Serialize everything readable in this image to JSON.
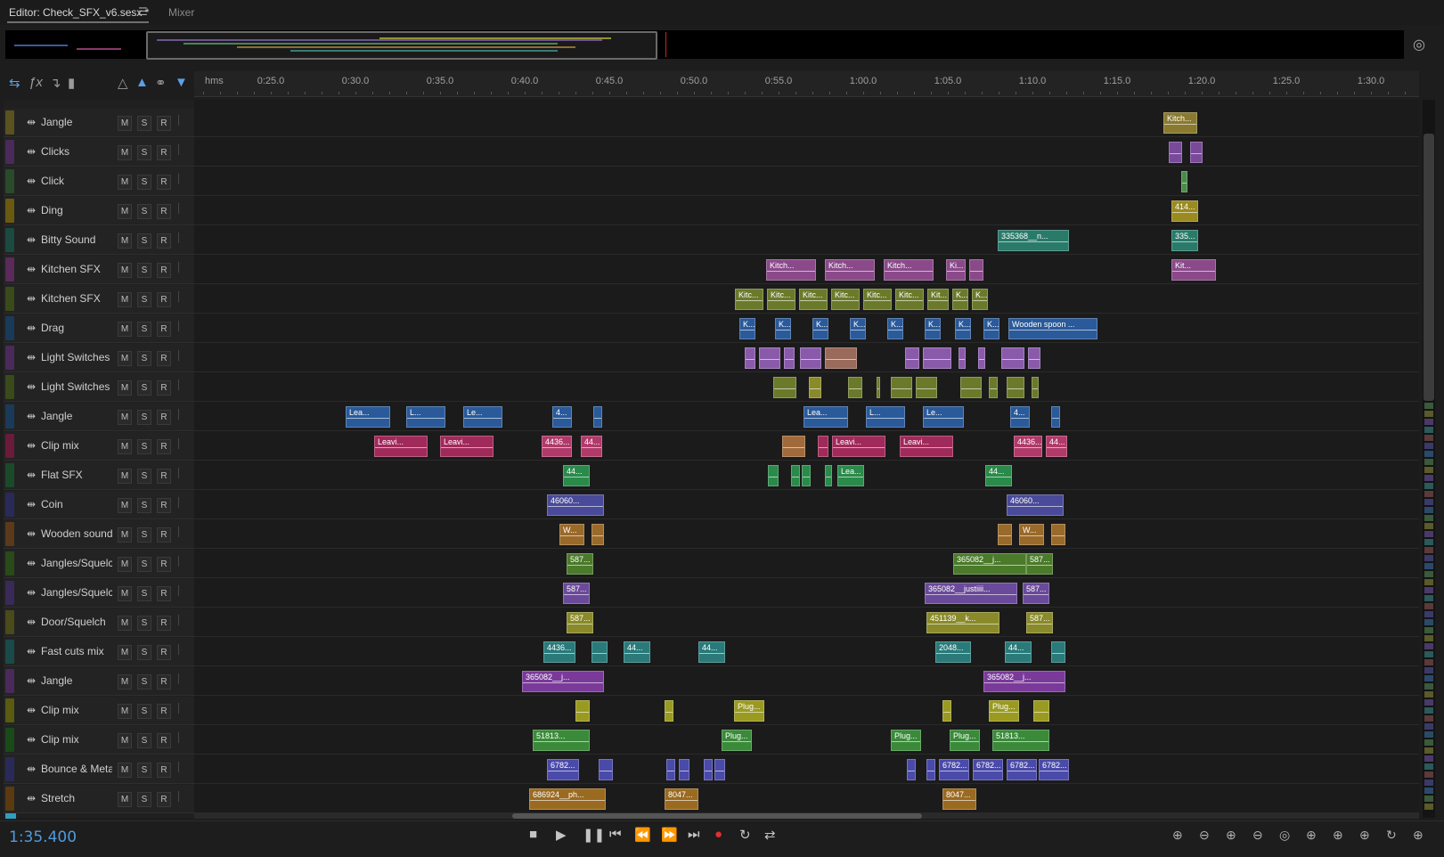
{
  "tabs": {
    "editor_label": "Editor: Check_SFX_v6.sesx *",
    "menu_icon": "hamburger-menu-icon",
    "mixer_label": "Mixer"
  },
  "ruler": {
    "unit_label": "hms",
    "labels": [
      "0:25.0",
      "0:30.0",
      "0:35.0",
      "0:40.0",
      "0:45.0",
      "0:50.0",
      "0:55.0",
      "1:00.0",
      "1:05.0",
      "1:10.0",
      "1:15.0",
      "1:20.0",
      "1:25.0",
      "1:30.0"
    ]
  },
  "button_labels": {
    "mute": "M",
    "solo": "S",
    "record": "R"
  },
  "tracks": [
    {
      "name": "Jangle",
      "color": "#5a5220",
      "clips": [
        {
          "s": 1306,
          "w": 38,
          "label": "Kitch...",
          "color": "#8a7a30"
        }
      ]
    },
    {
      "name": "Clicks",
      "color": "#4a2a5a",
      "clips": [
        {
          "s": 1312,
          "w": 15,
          "label": "",
          "color": "#7a4a9a"
        },
        {
          "s": 1336,
          "w": 14,
          "label": "",
          "color": "#7a4a9a"
        }
      ]
    },
    {
      "name": "Click",
      "color": "#2a4a2a",
      "clips": [
        {
          "s": 1326,
          "w": 7,
          "label": "",
          "color": "#4a8a4a"
        }
      ]
    },
    {
      "name": "Ding",
      "color": "#6a5a10",
      "clips": [
        {
          "s": 1315,
          "w": 30,
          "label": "414...",
          "color": "#9a8a20"
        }
      ]
    },
    {
      "name": "Bitty Sound",
      "color": "#1a4a40",
      "clips": [
        {
          "s": 1120,
          "w": 80,
          "label": "335368__n...",
          "color": "#2a7a6a"
        },
        {
          "s": 1315,
          "w": 30,
          "label": "335...",
          "color": "#2a7a6a"
        }
      ]
    },
    {
      "name": "Kitchen SFX",
      "color": "#5a2a5a",
      "clips": [
        {
          "s": 860,
          "w": 56,
          "label": "Kitch...",
          "color": "#8a4a8a"
        },
        {
          "s": 926,
          "w": 56,
          "label": "Kitch...",
          "color": "#8a4a8a"
        },
        {
          "s": 992,
          "w": 56,
          "label": "Kitch...",
          "color": "#8a4a8a"
        },
        {
          "s": 1062,
          "w": 22,
          "label": "Ki...",
          "color": "#8a4a8a"
        },
        {
          "s": 1088,
          "w": 16,
          "label": "",
          "color": "#8a4a8a"
        },
        {
          "s": 1315,
          "w": 50,
          "label": "Kit...",
          "color": "#8a4a8a"
        }
      ]
    },
    {
      "name": "Kitchen SFX",
      "color": "#3a4a1a",
      "clips": [
        {
          "s": 825,
          "w": 32,
          "label": "Kitc...",
          "color": "#6a7a2a"
        },
        {
          "s": 861,
          "w": 32,
          "label": "Kitc...",
          "color": "#6a7a2a"
        },
        {
          "s": 897,
          "w": 32,
          "label": "Kitc...",
          "color": "#6a7a2a"
        },
        {
          "s": 933,
          "w": 32,
          "label": "Kitc...",
          "color": "#6a7a2a"
        },
        {
          "s": 969,
          "w": 32,
          "label": "Kitc...",
          "color": "#6a7a2a"
        },
        {
          "s": 1005,
          "w": 32,
          "label": "Kitc...",
          "color": "#6a7a2a"
        },
        {
          "s": 1041,
          "w": 24,
          "label": "Kit...",
          "color": "#6a7a2a"
        },
        {
          "s": 1069,
          "w": 18,
          "label": "K...",
          "color": "#6a7a2a"
        },
        {
          "s": 1091,
          "w": 18,
          "label": "K...",
          "color": "#6a7a2a"
        }
      ]
    },
    {
      "name": "Drag",
      "color": "#1a3a5a",
      "clips": [
        {
          "s": 830,
          "w": 18,
          "label": "K...",
          "color": "#2a5a9a"
        },
        {
          "s": 870,
          "w": 18,
          "label": "K...",
          "color": "#2a5a9a"
        },
        {
          "s": 912,
          "w": 18,
          "label": "K...",
          "color": "#2a5a9a"
        },
        {
          "s": 954,
          "w": 18,
          "label": "K...",
          "color": "#2a5a9a"
        },
        {
          "s": 996,
          "w": 18,
          "label": "K...",
          "color": "#2a5a9a"
        },
        {
          "s": 1038,
          "w": 18,
          "label": "K...",
          "color": "#2a5a9a"
        },
        {
          "s": 1072,
          "w": 18,
          "label": "K...",
          "color": "#2a5a9a"
        },
        {
          "s": 1104,
          "w": 18,
          "label": "K...",
          "color": "#2a5a9a"
        },
        {
          "s": 1132,
          "w": 100,
          "label": "Wooden spoon ...",
          "color": "#2a5a9a"
        }
      ]
    },
    {
      "name": "Light Switches",
      "color": "#4a2a5a",
      "clips": [
        {
          "s": 836,
          "w": 12,
          "label": "",
          "color": "#8a5aaa"
        },
        {
          "s": 852,
          "w": 24,
          "label": "",
          "color": "#8a5aaa"
        },
        {
          "s": 880,
          "w": 12,
          "label": "",
          "color": "#8a5aaa"
        },
        {
          "s": 898,
          "w": 24,
          "label": "",
          "color": "#8a5aaa"
        },
        {
          "s": 926,
          "w": 36,
          "label": "",
          "color": "#9a6a5a"
        },
        {
          "s": 1016,
          "w": 16,
          "label": "",
          "color": "#8a5aaa"
        },
        {
          "s": 1036,
          "w": 32,
          "label": "",
          "color": "#8a5aaa"
        },
        {
          "s": 1076,
          "w": 8,
          "label": "",
          "color": "#8a5aaa"
        },
        {
          "s": 1098,
          "w": 8,
          "label": "",
          "color": "#8a5aaa"
        },
        {
          "s": 1124,
          "w": 26,
          "label": "",
          "color": "#8a5aaa"
        },
        {
          "s": 1154,
          "w": 14,
          "label": "",
          "color": "#8a5aaa"
        }
      ]
    },
    {
      "name": "Light Switches",
      "color": "#3a4a1a",
      "clips": [
        {
          "s": 868,
          "w": 26,
          "label": "",
          "color": "#6a7a2a"
        },
        {
          "s": 908,
          "w": 14,
          "label": "",
          "color": "#8a8a2a"
        },
        {
          "s": 952,
          "w": 16,
          "label": "",
          "color": "#6a7a2a"
        },
        {
          "s": 984,
          "w": 4,
          "label": "",
          "color": "#6a7a2a"
        },
        {
          "s": 1000,
          "w": 24,
          "label": "",
          "color": "#6a7a2a"
        },
        {
          "s": 1028,
          "w": 24,
          "label": "",
          "color": "#6a7a2a"
        },
        {
          "s": 1078,
          "w": 24,
          "label": "",
          "color": "#6a7a2a"
        },
        {
          "s": 1110,
          "w": 10,
          "label": "",
          "color": "#6a7a2a"
        },
        {
          "s": 1130,
          "w": 20,
          "label": "",
          "color": "#6a7a2a"
        },
        {
          "s": 1158,
          "w": 8,
          "label": "",
          "color": "#6a7a2a"
        }
      ]
    },
    {
      "name": "Jangle",
      "color": "#1a3a5a",
      "clips": [
        {
          "s": 388,
          "w": 50,
          "label": "Lea...",
          "color": "#2a5a9a"
        },
        {
          "s": 456,
          "w": 44,
          "label": "L...",
          "color": "#2a5a9a"
        },
        {
          "s": 520,
          "w": 44,
          "label": "Le...",
          "color": "#2a5a9a"
        },
        {
          "s": 620,
          "w": 22,
          "label": "4...",
          "color": "#2a5a9a"
        },
        {
          "s": 666,
          "w": 10,
          "label": "",
          "color": "#2a5a9a"
        },
        {
          "s": 902,
          "w": 50,
          "label": "Lea...",
          "color": "#2a5a9a"
        },
        {
          "s": 972,
          "w": 44,
          "label": "L...",
          "color": "#2a5a9a"
        },
        {
          "s": 1036,
          "w": 46,
          "label": "Le...",
          "color": "#2a5a9a"
        },
        {
          "s": 1134,
          "w": 22,
          "label": "4...",
          "color": "#2a5a9a"
        },
        {
          "s": 1180,
          "w": 10,
          "label": "",
          "color": "#2a5a9a"
        }
      ]
    },
    {
      "name": "Clip mix",
      "color": "#6a1a3a",
      "clips": [
        {
          "s": 420,
          "w": 60,
          "label": "Leavi...",
          "color": "#a02a5a"
        },
        {
          "s": 494,
          "w": 60,
          "label": "Leavi...",
          "color": "#a02a5a"
        },
        {
          "s": 608,
          "w": 34,
          "label": "4436...",
          "color": "#b03a6a"
        },
        {
          "s": 652,
          "w": 24,
          "label": "44...",
          "color": "#b03a6a"
        },
        {
          "s": 878,
          "w": 26,
          "label": "",
          "color": "#a06a3a"
        },
        {
          "s": 918,
          "w": 12,
          "label": "",
          "color": "#a02a5a"
        },
        {
          "s": 934,
          "w": 60,
          "label": "Leavi...",
          "color": "#a02a5a"
        },
        {
          "s": 1010,
          "w": 60,
          "label": "Leavi...",
          "color": "#a02a5a"
        },
        {
          "s": 1138,
          "w": 32,
          "label": "4436...",
          "color": "#b03a6a"
        },
        {
          "s": 1174,
          "w": 24,
          "label": "44...",
          "color": "#b03a6a"
        }
      ]
    },
    {
      "name": "Flat SFX",
      "color": "#1a4a2a",
      "clips": [
        {
          "s": 632,
          "w": 30,
          "label": "44...",
          "color": "#2a8a4a"
        },
        {
          "s": 862,
          "w": 12,
          "label": "",
          "color": "#2a8a4a"
        },
        {
          "s": 888,
          "w": 10,
          "label": "",
          "color": "#2a8a4a"
        },
        {
          "s": 900,
          "w": 10,
          "label": "",
          "color": "#2a8a4a"
        },
        {
          "s": 926,
          "w": 8,
          "label": "",
          "color": "#2a8a4a"
        },
        {
          "s": 940,
          "w": 30,
          "label": "Lea...",
          "color": "#2a8a4a"
        },
        {
          "s": 1106,
          "w": 30,
          "label": "44...",
          "color": "#2a8a4a"
        }
      ]
    },
    {
      "name": "Coin",
      "color": "#2a2a5a",
      "clips": [
        {
          "s": 614,
          "w": 64,
          "label": "46060...",
          "color": "#4a4a9a"
        },
        {
          "s": 1130,
          "w": 64,
          "label": "46060...",
          "color": "#4a4a9a"
        }
      ]
    },
    {
      "name": "Wooden sound",
      "color": "#5a3a1a",
      "clips": [
        {
          "s": 628,
          "w": 28,
          "label": "W...",
          "color": "#9a6a2a"
        },
        {
          "s": 664,
          "w": 14,
          "label": "",
          "color": "#9a6a2a"
        },
        {
          "s": 1120,
          "w": 16,
          "label": "",
          "color": "#9a6a2a"
        },
        {
          "s": 1144,
          "w": 28,
          "label": "W...",
          "color": "#9a6a2a"
        },
        {
          "s": 1180,
          "w": 16,
          "label": "",
          "color": "#9a6a2a"
        }
      ]
    },
    {
      "name": "Jangles/Squelc",
      "color": "#2a4a1a",
      "clips": [
        {
          "s": 636,
          "w": 30,
          "label": "587...",
          "color": "#4a7a2a"
        },
        {
          "s": 1070,
          "w": 82,
          "label": "365082__j...",
          "color": "#4a7a2a"
        },
        {
          "s": 1152,
          "w": 30,
          "label": "587...",
          "color": "#4a7a2a"
        }
      ]
    },
    {
      "name": "Jangles/Squelc",
      "color": "#3a2a5a",
      "clips": [
        {
          "s": 632,
          "w": 30,
          "label": "587...",
          "color": "#6a4a9a"
        },
        {
          "s": 1038,
          "w": 104,
          "label": "365082__justiiii...",
          "color": "#6a4a9a"
        },
        {
          "s": 1148,
          "w": 30,
          "label": "587...",
          "color": "#6a4a9a"
        }
      ]
    },
    {
      "name": "Door/Squelch",
      "color": "#4a4a1a",
      "clips": [
        {
          "s": 636,
          "w": 30,
          "label": "587...",
          "color": "#8a8a2a"
        },
        {
          "s": 1040,
          "w": 82,
          "label": "451139__k...",
          "color": "#8a8a2a"
        },
        {
          "s": 1152,
          "w": 30,
          "label": "587...",
          "color": "#8a8a2a"
        }
      ]
    },
    {
      "name": "Fast cuts mix",
      "color": "#1a4a4a",
      "clips": [
        {
          "s": 610,
          "w": 36,
          "label": "4436...",
          "color": "#2a7a7a"
        },
        {
          "s": 664,
          "w": 18,
          "label": "",
          "color": "#2a7a7a"
        },
        {
          "s": 700,
          "w": 30,
          "label": "44...",
          "color": "#2a7a7a"
        },
        {
          "s": 784,
          "w": 30,
          "label": "44...",
          "color": "#2a7a7a"
        },
        {
          "s": 1050,
          "w": 40,
          "label": "2048...",
          "color": "#2a7a7a"
        },
        {
          "s": 1128,
          "w": 30,
          "label": "44...",
          "color": "#2a7a7a"
        },
        {
          "s": 1180,
          "w": 16,
          "label": "",
          "color": "#2a7a7a"
        }
      ]
    },
    {
      "name": "Jangle",
      "color": "#4a2a5a",
      "clips": [
        {
          "s": 586,
          "w": 92,
          "label": "365082__j...",
          "color": "#7a3a9a"
        },
        {
          "s": 1104,
          "w": 92,
          "label": "365082__j...",
          "color": "#7a3a9a"
        }
      ]
    },
    {
      "name": "Clip mix",
      "color": "#5a5a10",
      "clips": [
        {
          "s": 646,
          "w": 16,
          "label": "",
          "color": "#9a9a20"
        },
        {
          "s": 746,
          "w": 10,
          "label": "",
          "color": "#9a9a20"
        },
        {
          "s": 824,
          "w": 34,
          "label": "Plug...",
          "color": "#9a9a20"
        },
        {
          "s": 1058,
          "w": 10,
          "label": "",
          "color": "#9a9a20"
        },
        {
          "s": 1110,
          "w": 34,
          "label": "Plug...",
          "color": "#9a9a20"
        },
        {
          "s": 1160,
          "w": 18,
          "label": "",
          "color": "#9a9a20"
        }
      ]
    },
    {
      "name": "Clip mix",
      "color": "#1a4a1a",
      "clips": [
        {
          "s": 598,
          "w": 64,
          "label": "51813...",
          "color": "#3a8a3a"
        },
        {
          "s": 810,
          "w": 34,
          "label": "Plug...",
          "color": "#3a8a3a"
        },
        {
          "s": 1000,
          "w": 34,
          "label": "Plug...",
          "color": "#3a8a3a"
        },
        {
          "s": 1066,
          "w": 34,
          "label": "Plug...",
          "color": "#3a8a3a"
        },
        {
          "s": 1114,
          "w": 64,
          "label": "51813...",
          "color": "#3a8a3a"
        }
      ]
    },
    {
      "name": "Bounce & Meta",
      "color": "#2a2a5a",
      "clips": [
        {
          "s": 614,
          "w": 36,
          "label": "6782...",
          "color": "#4a4aaa"
        },
        {
          "s": 672,
          "w": 16,
          "label": "",
          "color": "#4a4aaa"
        },
        {
          "s": 748,
          "w": 10,
          "label": "",
          "color": "#4a4aaa"
        },
        {
          "s": 762,
          "w": 12,
          "label": "",
          "color": "#4a4aaa"
        },
        {
          "s": 790,
          "w": 10,
          "label": "",
          "color": "#4a4aaa"
        },
        {
          "s": 802,
          "w": 12,
          "label": "",
          "color": "#4a4aaa"
        },
        {
          "s": 1018,
          "w": 10,
          "label": "",
          "color": "#4a4aaa"
        },
        {
          "s": 1040,
          "w": 10,
          "label": "",
          "color": "#4a4aaa"
        },
        {
          "s": 1054,
          "w": 34,
          "label": "6782...",
          "color": "#4a4aaa"
        },
        {
          "s": 1092,
          "w": 34,
          "label": "6782...",
          "color": "#4a4aaa"
        },
        {
          "s": 1130,
          "w": 34,
          "label": "6782...",
          "color": "#4a4aaa"
        },
        {
          "s": 1166,
          "w": 34,
          "label": "6782...",
          "color": "#4a4aaa"
        }
      ]
    },
    {
      "name": "Stretch",
      "color": "#5a3a10",
      "clips": [
        {
          "s": 594,
          "w": 86,
          "label": "686924__ph...",
          "color": "#9a6a20"
        },
        {
          "s": 746,
          "w": 38,
          "label": "8047...",
          "color": "#9a6a20"
        },
        {
          "s": 1058,
          "w": 38,
          "label": "8047...",
          "color": "#9a6a20"
        }
      ]
    }
  ],
  "status": {
    "timecode": "1:35.400"
  },
  "colors": {
    "accent": "#4f9be0",
    "record": "#e03030"
  }
}
